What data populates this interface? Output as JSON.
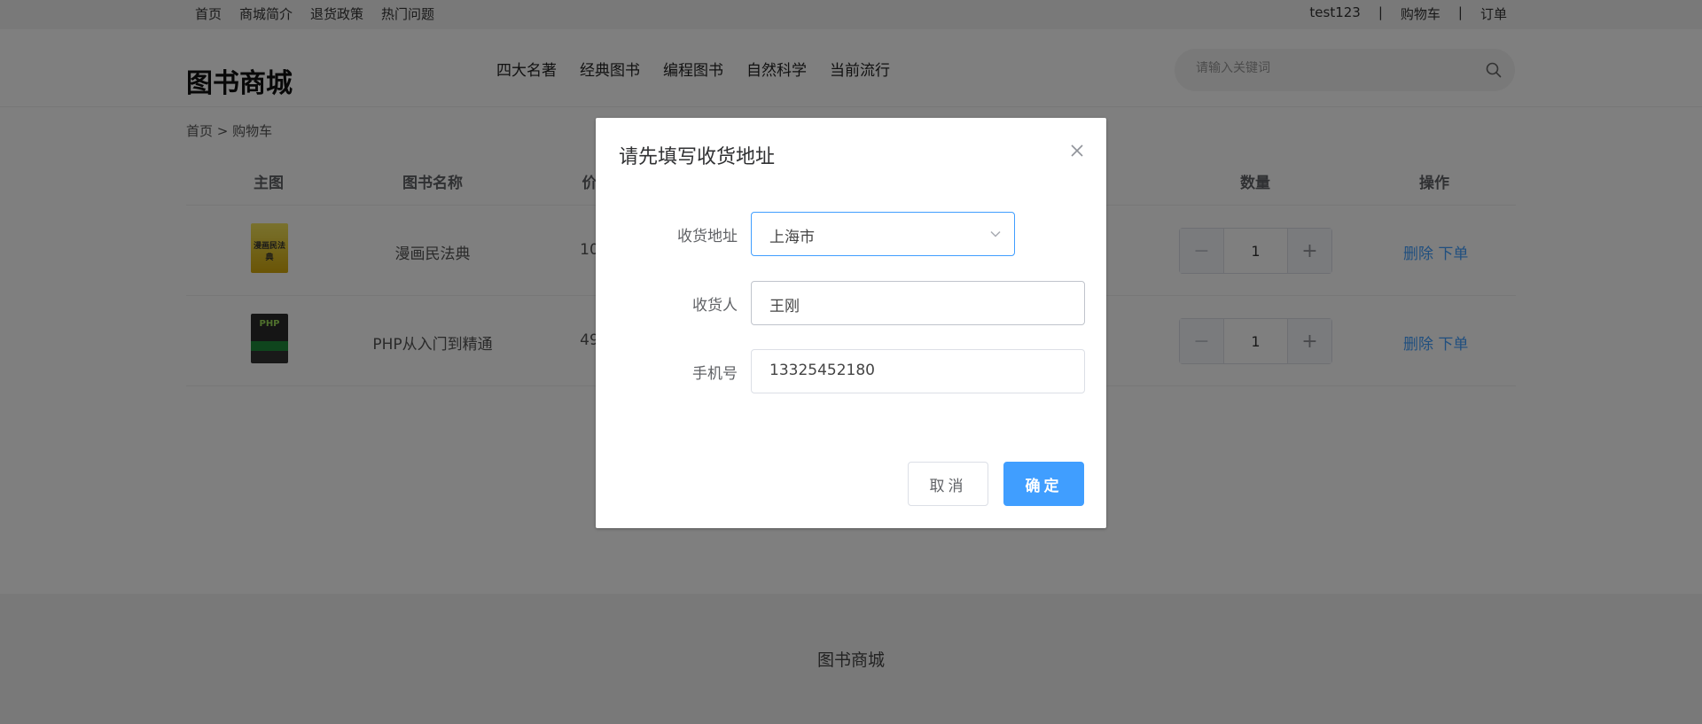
{
  "topbar": {
    "left_links": [
      "首页",
      "商城简介",
      "退货政策",
      "热门问题"
    ],
    "user": "test123",
    "sep": "|",
    "cart": "购物车",
    "orders": "订单"
  },
  "header": {
    "logo": "图书商城",
    "nav": [
      "四大名著",
      "经典图书",
      "编程图书",
      "自然科学",
      "当前流行"
    ],
    "search_placeholder": "请输入关键词"
  },
  "breadcrumb": "首页 > 购物车",
  "table": {
    "headers": {
      "image": "主图",
      "name": "图书名称",
      "price": "价",
      "qty": "数量",
      "actions": "操作"
    },
    "rows": [
      {
        "cover_text": "漫画民法典",
        "name": "漫画民法典",
        "price": "10",
        "qty": "1",
        "delete": "删除",
        "order": "下单"
      },
      {
        "cover_text": "PHP",
        "name": "PHP从入门到精通",
        "price": "49",
        "qty": "1",
        "delete": "删除",
        "order": "下单"
      }
    ]
  },
  "footer": {
    "text": "图书商城"
  },
  "dialog": {
    "title": "请先填写收货地址",
    "address_label": "收货地址",
    "address_value": "上海市",
    "receiver_label": "收货人",
    "receiver_value": "王刚",
    "phone_label": "手机号",
    "phone_value": "13325452180",
    "cancel": "取消",
    "confirm": "确定"
  },
  "colors": {
    "primary": "#409eff",
    "overlay": "rgba(0,0,0,0.5)"
  }
}
